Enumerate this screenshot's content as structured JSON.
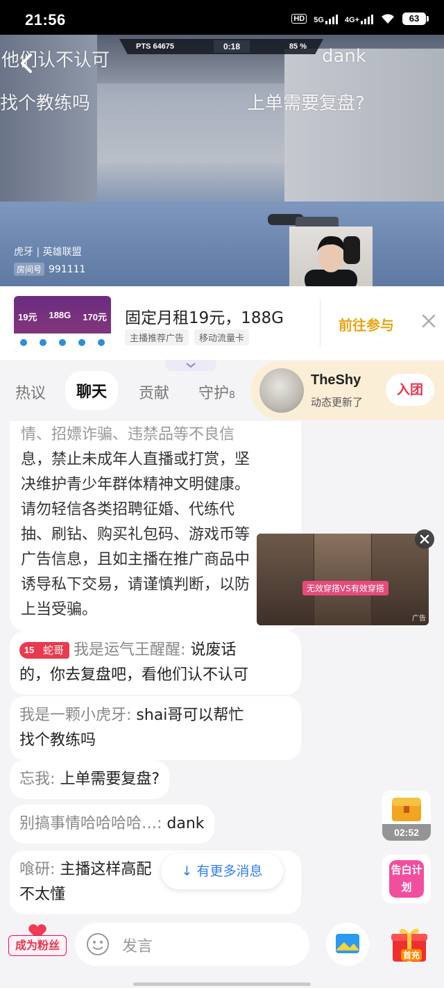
{
  "status_bar": {
    "time": "21:56",
    "network_1": "5G",
    "network_2": "4G+",
    "hd_label": "HD",
    "battery": "63"
  },
  "video": {
    "hud": {
      "points": "PTS 64675",
      "timer": "0:18",
      "percent": "85 %"
    },
    "danmaku": [
      "他们认不认可",
      "dank",
      "找个教练吗",
      "上单需要复盘?"
    ],
    "channel": "虎牙 | 英雄联盟",
    "room_tag": "房间号",
    "room_id": "991111"
  },
  "ad_banner": {
    "thumb_prices": [
      "19元",
      "188G",
      "170元"
    ],
    "title": "固定月租19元，188G",
    "tags": [
      "主播推荐广告",
      "移动流量卡"
    ],
    "cta": "前往参与"
  },
  "tabs": [
    {
      "label": "热议"
    },
    {
      "label": "聊天",
      "active": true
    },
    {
      "label": "贡献"
    },
    {
      "label": "守护",
      "count": "8"
    }
  ],
  "streamer_card": {
    "name": "TheShy",
    "subtitle": "动态更新了",
    "join_label": "入团"
  },
  "chat": {
    "notice_faded": "情、招嫖诈骗、违禁品等不良信",
    "notice_lines": [
      "息，禁止未成年人直播或打赏，坚",
      "决维护青少年群体精神文明健康。",
      "请勿轻信各类招聘征婚、代练代",
      "抽、刷钻、购买礼包码、游戏币等",
      "广告信息，且如主播在推广商品中",
      "诱导私下交易，请谨慎判断，以防",
      "上当受骗。"
    ],
    "messages": [
      {
        "badge_level": "15",
        "badge_name": "蛇哥",
        "nick": "我是运气王醒醒:",
        "line1": "说废话",
        "line2": "的，你去复盘吧，看他们认不认可"
      },
      {
        "nick": "我是一颗小虎牙:",
        "line1": "shai哥可以帮忙",
        "line2": "找个教练吗"
      },
      {
        "nick": "忘我:",
        "line1": "上单需要复盘?"
      },
      {
        "nick": "别搞事情哈哈哈哈…:",
        "line1": "dank"
      },
      {
        "nick": "喰研:",
        "line1": "主播这样高配",
        "line2": "不太懂"
      }
    ],
    "more_messages": "↓ 有更多消息"
  },
  "float_ad": {
    "caption": "无效穿搭VS有效穿搭",
    "ad_label": "广告"
  },
  "widgets": {
    "chest_timer": "02:52",
    "confess_label": "告白计划"
  },
  "bottom_bar": {
    "fan_label": "成为粉丝",
    "input_placeholder": "发言",
    "gift_label": "首充"
  },
  "colors": {
    "accent_red": "#e8344f",
    "cta_gold": "#e7a413",
    "link_blue": "#2f7ff0",
    "card_bg": "#fbeed6"
  }
}
